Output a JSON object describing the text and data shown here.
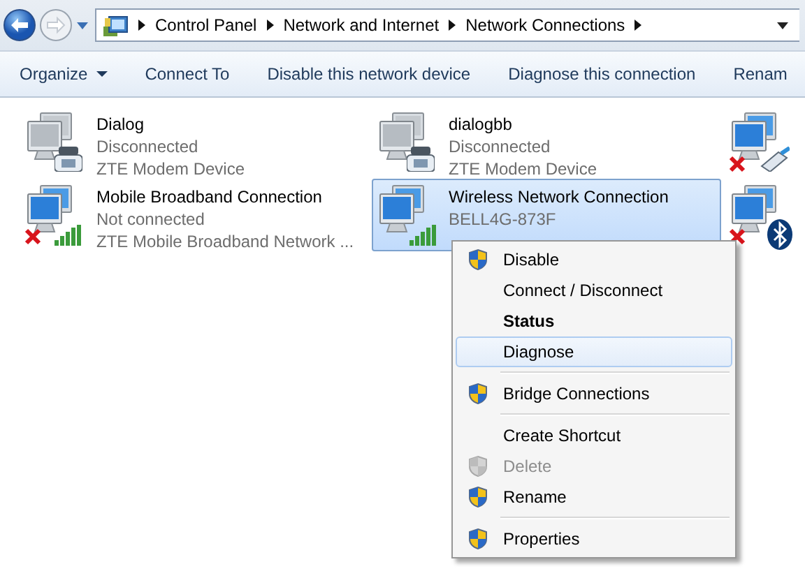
{
  "address_bar": {
    "segments": [
      "Control Panel",
      "Network and Internet",
      "Network Connections"
    ]
  },
  "toolbar": [
    {
      "label": "Organize",
      "kind": "menu"
    },
    {
      "label": "Connect To",
      "kind": "button"
    },
    {
      "label": "Disable this network device",
      "kind": "button"
    },
    {
      "label": "Diagnose this connection",
      "kind": "button"
    },
    {
      "label": "Renam",
      "kind": "button"
    }
  ],
  "connections": [
    {
      "name": "Dialog",
      "status": "Disconnected",
      "device": "ZTE Modem Device",
      "kind": "dialup",
      "unavailable": false,
      "selected": false
    },
    {
      "name": "dialogbb",
      "status": "Disconnected",
      "device": "ZTE Modem Device",
      "kind": "dialup",
      "unavailable": false,
      "selected": false
    },
    {
      "kind": "ethernet",
      "unavailable": true,
      "selected": false
    },
    {
      "name": "Mobile Broadband Connection",
      "status": "Not connected",
      "device": "ZTE Mobile Broadband Network ...",
      "kind": "broadband",
      "unavailable": true,
      "selected": false
    },
    {
      "name": "Wireless Network Connection",
      "status": "BELL4G-873F",
      "kind": "wireless",
      "unavailable": false,
      "selected": true
    },
    {
      "kind": "bluetooth",
      "unavailable": true,
      "selected": false
    }
  ],
  "context_menu": [
    {
      "label": "Disable",
      "kind": "item",
      "shield": true,
      "bold": false,
      "disabled": false,
      "selected": false
    },
    {
      "label": "Connect / Disconnect",
      "kind": "item",
      "shield": false,
      "bold": false,
      "disabled": false,
      "selected": false
    },
    {
      "label": "Status",
      "kind": "item",
      "shield": false,
      "bold": true,
      "disabled": false,
      "selected": false
    },
    {
      "label": "Diagnose",
      "kind": "item",
      "shield": false,
      "bold": false,
      "disabled": false,
      "selected": true
    },
    {
      "kind": "separator"
    },
    {
      "label": "Bridge Connections",
      "kind": "item",
      "shield": true,
      "bold": false,
      "disabled": false,
      "selected": false
    },
    {
      "kind": "separator"
    },
    {
      "label": "Create Shortcut",
      "kind": "item",
      "shield": false,
      "bold": false,
      "disabled": false,
      "selected": false
    },
    {
      "label": "Delete",
      "kind": "item",
      "shield": true,
      "bold": false,
      "disabled": true,
      "selected": false
    },
    {
      "label": "Rename",
      "kind": "item",
      "shield": true,
      "bold": false,
      "disabled": false,
      "selected": false
    },
    {
      "kind": "separator"
    },
    {
      "label": "Properties",
      "kind": "item",
      "shield": true,
      "bold": false,
      "disabled": false,
      "selected": false
    }
  ]
}
